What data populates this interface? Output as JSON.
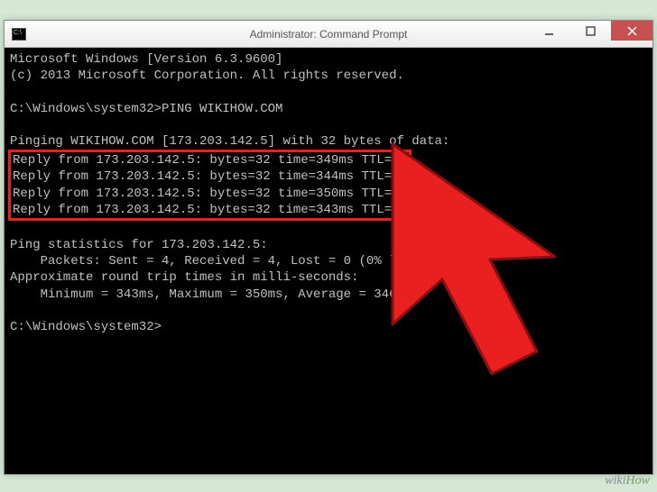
{
  "window": {
    "title": "Administrator: Command Prompt"
  },
  "terminal": {
    "line1": "Microsoft Windows [Version 6.3.9600]",
    "line2": "(c) 2013 Microsoft Corporation. All rights reserved.",
    "blank1": "",
    "prompt1": "C:\\Windows\\system32>PING WIKIHOW.COM",
    "blank2": "",
    "pinging": "Pinging WIKIHOW.COM [173.203.142.5] with 32 bytes of data:",
    "reply1": "Reply from 173.203.142.5: bytes=32 time=349ms TTL=45",
    "reply2": "Reply from 173.203.142.5: bytes=32 time=344ms TTL=45",
    "reply3": "Reply from 173.203.142.5: bytes=32 time=350ms TTL=45",
    "reply4": "Reply from 173.203.142.5: bytes=32 time=343ms TTL=45",
    "blank3": "",
    "stats1": "Ping statistics for 173.203.142.5:",
    "stats2": "    Packets: Sent = 4, Received = 4, Lost = 0 (0% loss),",
    "stats3": "Approximate round trip times in milli-seconds:",
    "stats4": "    Minimum = 343ms, Maximum = 350ms, Average = 346ms",
    "blank4": "",
    "prompt2": "C:\\Windows\\system32>"
  },
  "watermark": {
    "wiki": "wiki",
    "how": "How"
  }
}
